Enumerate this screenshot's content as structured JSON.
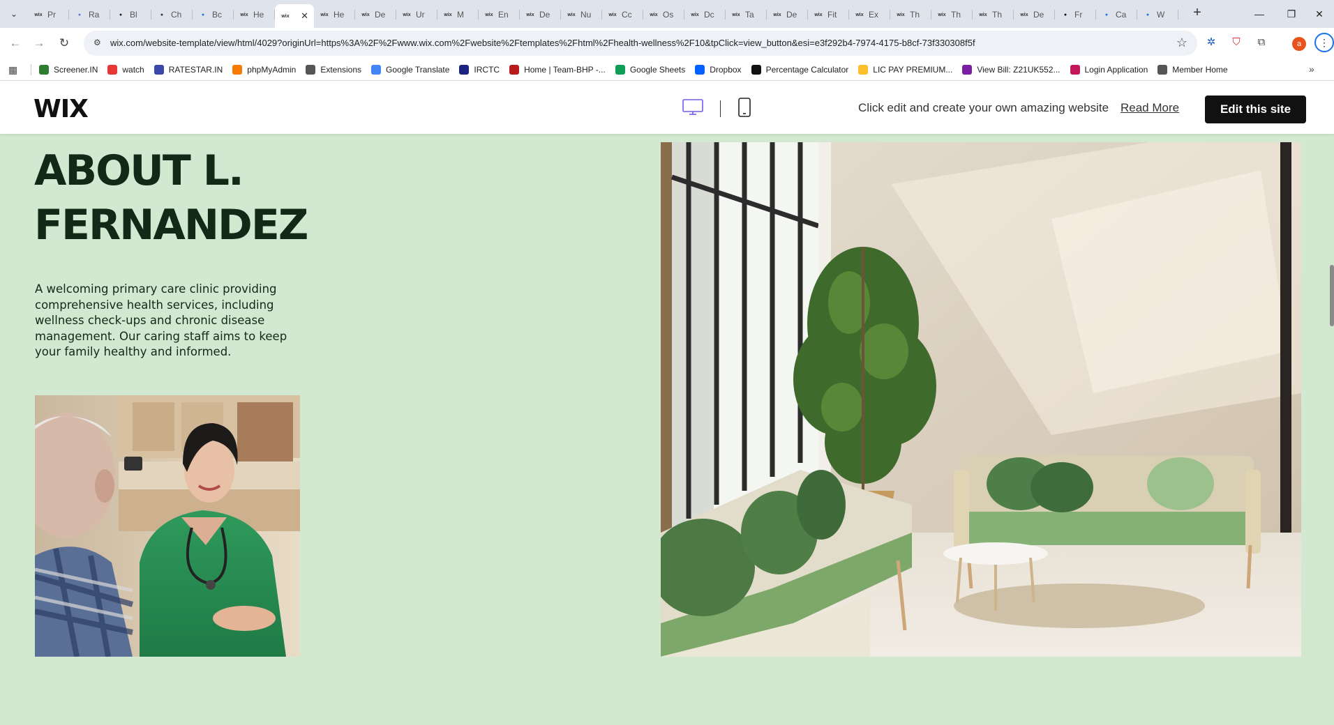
{
  "browser": {
    "tabs": [
      {
        "label": "Pr",
        "icon": "wix-icon",
        "color": "#333333"
      },
      {
        "label": "Ra",
        "icon": "globe-icon",
        "color": "#5b7fd6"
      },
      {
        "label": "Bl",
        "icon": "wikipedia-icon",
        "color": "#222222"
      },
      {
        "label": "Ch",
        "icon": "chatgpt-icon",
        "color": "#333333"
      },
      {
        "label": "Bc",
        "icon": "star-icon",
        "color": "#1a73e8"
      },
      {
        "label": "He",
        "icon": "wix-icon",
        "color": "#333333"
      },
      {
        "label": "",
        "icon": "wix-icon",
        "color": "#333333",
        "active": true
      },
      {
        "label": "He",
        "icon": "wix-icon",
        "color": "#333333"
      },
      {
        "label": "De",
        "icon": "wix-icon",
        "color": "#333333"
      },
      {
        "label": "Ur",
        "icon": "wix-icon",
        "color": "#333333"
      },
      {
        "label": "M",
        "icon": "wix-icon",
        "color": "#333333"
      },
      {
        "label": "En",
        "icon": "wix-icon",
        "color": "#333333"
      },
      {
        "label": "De",
        "icon": "wix-icon",
        "color": "#333333"
      },
      {
        "label": "Nu",
        "icon": "wix-icon",
        "color": "#333333"
      },
      {
        "label": "Cc",
        "icon": "wix-icon",
        "color": "#333333"
      },
      {
        "label": "Os",
        "icon": "wix-icon",
        "color": "#333333"
      },
      {
        "label": "Dc",
        "icon": "wix-icon",
        "color": "#333333"
      },
      {
        "label": "Ta",
        "icon": "wix-icon",
        "color": "#333333"
      },
      {
        "label": "De",
        "icon": "wix-icon",
        "color": "#333333"
      },
      {
        "label": "Fit",
        "icon": "wix-icon",
        "color": "#333333"
      },
      {
        "label": "Ex",
        "icon": "wix-icon",
        "color": "#333333"
      },
      {
        "label": "Th",
        "icon": "wix-icon",
        "color": "#333333"
      },
      {
        "label": "Th",
        "icon": "wix-icon",
        "color": "#333333"
      },
      {
        "label": "Th",
        "icon": "wix-icon",
        "color": "#333333"
      },
      {
        "label": "De",
        "icon": "wix-icon",
        "color": "#333333"
      },
      {
        "label": "Fr",
        "icon": "framer-icon",
        "color": "#111111"
      },
      {
        "label": "Ca",
        "icon": "doc-icon",
        "color": "#1a73e8"
      },
      {
        "label": "W",
        "icon": "doc-icon",
        "color": "#1a73e8"
      }
    ],
    "url": "wix.com/website-template/view/html/4029?originUrl=https%3A%2F%2Fwww.wix.com%2Fwebsite%2Ftemplates%2Fhtml%2Fhealth-wellness%2F10&tpClick=view_button&esi=e3f292b4-7974-4175-b8cf-73f330308f5f",
    "profile_initial": "a",
    "bookmarks": [
      {
        "label": "Screener.IN",
        "icon": "chart-icon",
        "color": "#2e7d32"
      },
      {
        "label": "watch",
        "icon": "youtube-icon",
        "color": "#e53935"
      },
      {
        "label": "RATESTAR.IN",
        "icon": "ratestar-icon",
        "color": "#3949ab"
      },
      {
        "label": "phpMyAdmin",
        "icon": "phpmyadmin-icon",
        "color": "#f57c00"
      },
      {
        "label": "Extensions",
        "icon": "puzzle-icon",
        "color": "#555555"
      },
      {
        "label": "Google Translate",
        "icon": "translate-icon",
        "color": "#4285f4"
      },
      {
        "label": "IRCTC",
        "icon": "irctc-icon",
        "color": "#1a237e"
      },
      {
        "label": "Home | Team-BHP -...",
        "icon": "teambhp-icon",
        "color": "#b71c1c"
      },
      {
        "label": "Google Sheets",
        "icon": "sheets-icon",
        "color": "#0f9d58"
      },
      {
        "label": "Dropbox",
        "icon": "dropbox-icon",
        "color": "#0061ff"
      },
      {
        "label": "Percentage Calculator",
        "icon": "percent-icon",
        "color": "#111111"
      },
      {
        "label": "LIC PAY PREMIUM...",
        "icon": "lic-icon",
        "color": "#fbc02d"
      },
      {
        "label": "View Bill: Z21UK552...",
        "icon": "bill-icon",
        "color": "#7b1fa2"
      },
      {
        "label": "Login Application",
        "icon": "login-icon",
        "color": "#c2185b"
      },
      {
        "label": "Member Home",
        "icon": "globe-icon",
        "color": "#555555"
      }
    ]
  },
  "wix_header": {
    "logo": "WIX",
    "promo_text": "Click edit and create your own amazing website",
    "read_more": "Read More",
    "edit_button": "Edit this site",
    "accent": "#6c5ce7"
  },
  "page": {
    "title_line1": "ABOUT L.",
    "title_line2": "FERNANDEZ",
    "description": "A welcoming primary care clinic providing comprehensive health services, including wellness check-ups and chronic disease management. Our caring staff aims to keep your family healthy and informed.",
    "background": "#d3e8d1",
    "text_color": "#112a17"
  }
}
